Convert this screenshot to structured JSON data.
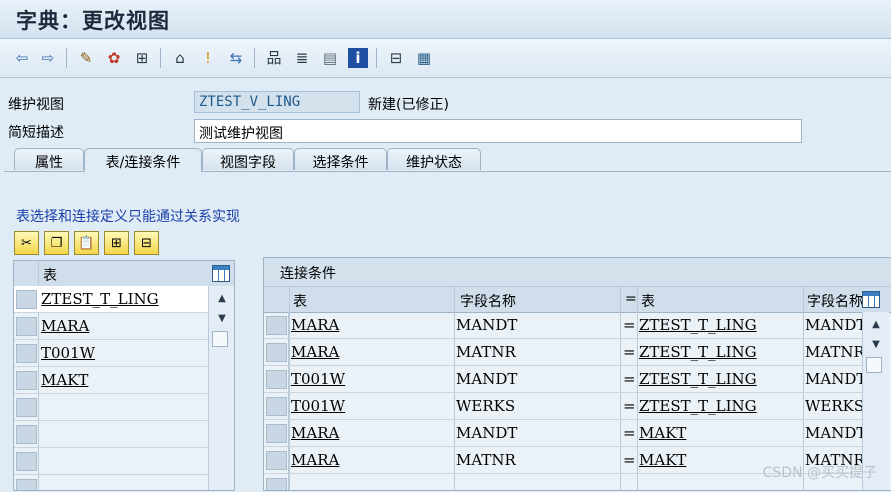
{
  "window": {
    "title": "字典：更改视图"
  },
  "toolbar": {
    "buttons": [
      "back-icon",
      "forward-icon",
      "display-change-icon",
      "activate-icon",
      "check-icon",
      "where-used-icon",
      "object-list-icon",
      "navigate-icon",
      "hierarchy-icon",
      "documentation-icon",
      "layout-icon",
      "info-icon",
      "columns-icon",
      "table-icon"
    ]
  },
  "form": {
    "view_label": "维护视图",
    "view_value": "ZTEST_V_LING",
    "view_status": "新建(已修正)",
    "desc_label": "简短描述",
    "desc_value": "测试维护视图"
  },
  "tabs": [
    {
      "label": "属性",
      "active": false
    },
    {
      "label": "表/连接条件",
      "active": true
    },
    {
      "label": "视图字段",
      "active": false
    },
    {
      "label": "选择条件",
      "active": false
    },
    {
      "label": "维护状态",
      "active": false
    }
  ],
  "panel": {
    "info_text": "表选择和连接定义只能通过关系实现",
    "action_buttons": [
      "cut-icon",
      "copy-icon",
      "paste-icon",
      "insert-row-icon",
      "delete-row-icon"
    ]
  },
  "tables_list": {
    "header": "表",
    "rows": [
      "ZTEST_T_LING",
      "MARA",
      "T001W",
      "MAKT",
      "",
      "",
      "",
      ""
    ]
  },
  "join_conditions": {
    "title": "连接条件",
    "headers": {
      "table1": "表",
      "field1": "字段名称",
      "eq": "=",
      "table2": "表",
      "field2": "字段名称"
    },
    "rows": [
      {
        "t1": "MARA",
        "f1": "MANDT",
        "eq": "=",
        "t2": "ZTEST_T_LING",
        "f2": "MANDT"
      },
      {
        "t1": "MARA",
        "f1": "MATNR",
        "eq": "=",
        "t2": "ZTEST_T_LING",
        "f2": "MATNR"
      },
      {
        "t1": "T001W",
        "f1": "MANDT",
        "eq": "=",
        "t2": "ZTEST_T_LING",
        "f2": "MANDT"
      },
      {
        "t1": "T001W",
        "f1": "WERKS",
        "eq": "=",
        "t2": "ZTEST_T_LING",
        "f2": "WERKS"
      },
      {
        "t1": "MARA",
        "f1": "MANDT",
        "eq": "=",
        "t2": "MAKT",
        "f2": "MANDT"
      },
      {
        "t1": "MARA",
        "f1": "MATNR",
        "eq": "=",
        "t2": "MAKT",
        "f2": "MATNR"
      },
      {
        "t1": "",
        "f1": "",
        "eq": "",
        "t2": "",
        "f2": ""
      }
    ]
  },
  "watermark": "CSDN @买买提子"
}
